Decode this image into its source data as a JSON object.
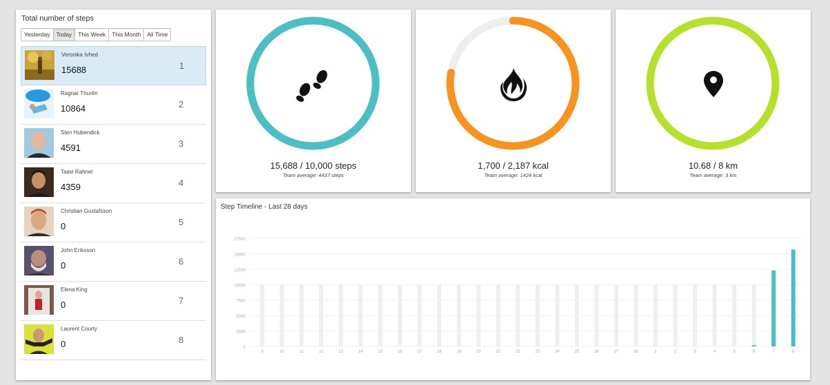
{
  "leaderboard": {
    "title": "Total number of steps",
    "tabs": [
      {
        "label": "Yesterday",
        "active": false
      },
      {
        "label": "Today",
        "active": true
      },
      {
        "label": "This Week",
        "active": false
      },
      {
        "label": "This Month",
        "active": false
      },
      {
        "label": "All Time",
        "active": false
      }
    ],
    "rows": [
      {
        "name": "Veronika Ivhed",
        "steps": "15688",
        "rank": "1",
        "highlight": true
      },
      {
        "name": "Ragnar Thurén",
        "steps": "10864",
        "rank": "2"
      },
      {
        "name": "Sten Hubendick",
        "steps": "4591",
        "rank": "3"
      },
      {
        "name": "Taavi Rahnel",
        "steps": "4359",
        "rank": "4"
      },
      {
        "name": "Christian Gustafsson",
        "steps": "0",
        "rank": "5"
      },
      {
        "name": "John Eriksson",
        "steps": "0",
        "rank": "6"
      },
      {
        "name": "Elena King",
        "steps": "0",
        "rank": "7"
      },
      {
        "name": "Laurent Courty",
        "steps": "0",
        "rank": "8"
      }
    ]
  },
  "gauges": {
    "steps": {
      "value_text": "15,688 / 10,000 steps",
      "avg_text": "Team average: 4437 steps",
      "progress": 1.0,
      "color": "#4bbfc3",
      "icon": "footprints-icon"
    },
    "kcal": {
      "value_text": "1,700 / 2,187 kcal",
      "avg_text": "Team average: 1424 kcal",
      "progress": 0.777,
      "color": "#f7931e",
      "icon": "flame-icon"
    },
    "km": {
      "value_text": "10.68 / 8 km",
      "avg_text": "Team average: 3 km",
      "progress": 1.0,
      "color": "#b5e12b",
      "icon": "map-pin-icon"
    }
  },
  "timeline": {
    "title": "Step Timeline - Last 28 days"
  },
  "chart_data": {
    "type": "bar",
    "ylim": [
      0,
      17500
    ],
    "yticks": [
      "17500",
      "15000",
      "12500",
      "10000",
      "7500",
      "5000",
      "2500",
      "0"
    ],
    "categories": [
      "9",
      "10",
      "11",
      "12",
      "13",
      "14",
      "15",
      "16",
      "17",
      "18",
      "19",
      "20",
      "21",
      "22",
      "23",
      "24",
      "25",
      "26",
      "27",
      "28",
      "1",
      "2",
      "3",
      "4",
      "5",
      "6",
      "7",
      "8"
    ],
    "goal": 10000,
    "values": [
      0,
      0,
      0,
      0,
      0,
      0,
      0,
      0,
      0,
      0,
      0,
      0,
      0,
      0,
      0,
      0,
      0,
      0,
      0,
      0,
      0,
      0,
      0,
      0,
      0,
      200,
      12300,
      15688
    ],
    "goal_color": "#efefef",
    "bar_color": "#4bbfc3"
  }
}
